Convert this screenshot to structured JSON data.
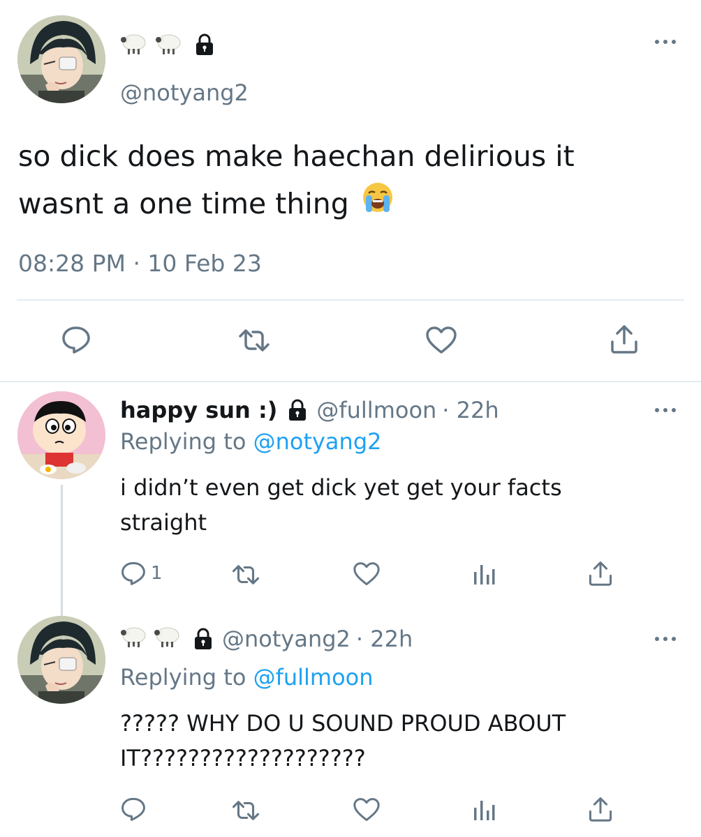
{
  "main_tweet": {
    "display_name_emojis": [
      "🐑",
      "🐑"
    ],
    "lock_icon": "lock-icon",
    "handle": "@notyang2",
    "text_line1": "so dick does make haechan delirious it",
    "text_line2": "wasnt a one time thing",
    "text_emoji": "😭",
    "timestamp": "08:28 PM · 10 Feb 23",
    "actions": [
      "reply-icon",
      "retweet-icon",
      "like-icon",
      "share-icon"
    ]
  },
  "reply1": {
    "display_name": "happy sun :)",
    "handle": "@fullmoon",
    "time": "· 22h",
    "replying_prefix": "Replying to",
    "replying_to": "@notyang2",
    "text_line1": "i didn’t even get dick yet get your facts",
    "text_line2": "straight",
    "reply_count": "1",
    "actions": [
      "reply-icon",
      "retweet-icon",
      "like-icon",
      "analytics-icon",
      "share-icon"
    ]
  },
  "reply2": {
    "display_name_emojis": [
      "🐑",
      "🐑"
    ],
    "handle": "@notyang2",
    "time": "· 22h",
    "replying_prefix": "Replying to",
    "replying_to": "@fullmoon",
    "text_line1": "????? WHY DO U SOUND PROUD ABOUT",
    "text_line2": "IT???????????????????",
    "actions": [
      "reply-icon",
      "retweet-icon",
      "like-icon",
      "analytics-icon",
      "share-icon"
    ]
  },
  "colors": {
    "text": "#14171a",
    "muted": "#657786",
    "link": "#1da1f2",
    "divider": "#e6ecf0"
  }
}
